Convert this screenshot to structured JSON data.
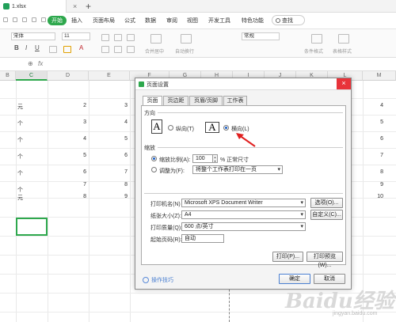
{
  "titlebar": {
    "file_name": "1.xlsx",
    "close": "×",
    "add": "+"
  },
  "menu": {
    "items": [
      "开始",
      "插入",
      "页面布局",
      "公式",
      "数据",
      "审阅",
      "视图",
      "开发工具",
      "特色功能"
    ],
    "search_label": "查找"
  },
  "toolbar": {
    "font_name": "宋体",
    "font_size": "11",
    "number_format": "常规",
    "labels": [
      "合并居中",
      "自动换行",
      "条件格式",
      "表格样式"
    ]
  },
  "formula_bar": {
    "zoom_icon": "⊕",
    "fx": "fx"
  },
  "grid": {
    "columns": [
      "B",
      "C",
      "D",
      "E",
      "F",
      "G",
      "H",
      "I",
      "J",
      "K",
      "L",
      "M"
    ],
    "units": [
      "元",
      "个",
      "个",
      "个",
      "个",
      "个",
      "元"
    ],
    "col_d": [
      "2",
      "3",
      "4",
      "5",
      "6",
      "7",
      "8"
    ],
    "col_e": [
      "3",
      "4",
      "5",
      "6",
      "7",
      "8",
      "9"
    ],
    "col_m": [
      "4",
      "5",
      "6",
      "7",
      "8",
      "9",
      "10"
    ]
  },
  "dialog": {
    "title": "页面设置",
    "close": "×",
    "tabs": [
      "页面",
      "页边距",
      "页眉/页脚",
      "工作表"
    ],
    "orientation": {
      "label": "方向",
      "icon_letter": "A",
      "portrait": "纵向(T)",
      "landscape": "横向(L)",
      "selected": "landscape"
    },
    "scaling": {
      "label": "缩放",
      "ratio_label": "缩放比例(A):",
      "ratio_value": "100",
      "ratio_suffix": "% 正常尺寸",
      "fit_label": "调整为(F):",
      "fit_value": "将整个工作表打印在一页"
    },
    "printer": {
      "printer_label": "打印机名(N)",
      "printer_value": "Microsoft XPS Document Writer",
      "options_button": "选项(O)...",
      "paper_label": "纸张大小(Z):",
      "paper_value": "A4",
      "custom_button": "自定义(C)...",
      "quality_label": "打印质量(Q):",
      "quality_value": "600 点/英寸",
      "first_page_label": "起始页码(R):",
      "first_page_value": "自动"
    },
    "print_button": "打印(P)...",
    "preview_button": "打印预览(W)...",
    "tips": "操作技巧",
    "ok_button": "确定",
    "cancel_button": "取消"
  },
  "watermark": {
    "text": "Baidu经验",
    "sub": "jingyan.baidu.com"
  },
  "colors": {
    "accent": "#2ea84d",
    "close_red": "#e8333a",
    "arrow_red": "#e02020",
    "link_blue": "#4a7fd1"
  }
}
